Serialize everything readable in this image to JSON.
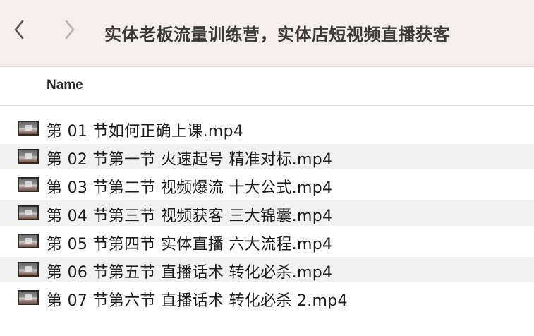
{
  "window": {
    "title": "实体老板流量训练营，实体店短视频直播获客"
  },
  "toolbar": {
    "back_icon": "chevron-left-icon",
    "forward_icon": "chevron-right-icon"
  },
  "columns": {
    "name": "Name"
  },
  "files": [
    {
      "name": "第 01 节如何正确上课.mp4"
    },
    {
      "name": "第 02 节第一节 火速起号 精准对标.mp4"
    },
    {
      "name": "第 03 节第二节 视频爆流 十大公式.mp4"
    },
    {
      "name": "第 04 节第三节 视频获客 三大锦囊.mp4"
    },
    {
      "name": "第 05 节第四节 实体直播 六大流程.mp4"
    },
    {
      "name": "第 06 节第五节 直播话术 转化必杀.mp4"
    },
    {
      "name": "第 07 节第六节 直播话术 转化必杀 2.mp4"
    }
  ],
  "colors": {
    "toolbar_bg": "#f4efec",
    "alt_row_bg": "#f1f1f2"
  }
}
